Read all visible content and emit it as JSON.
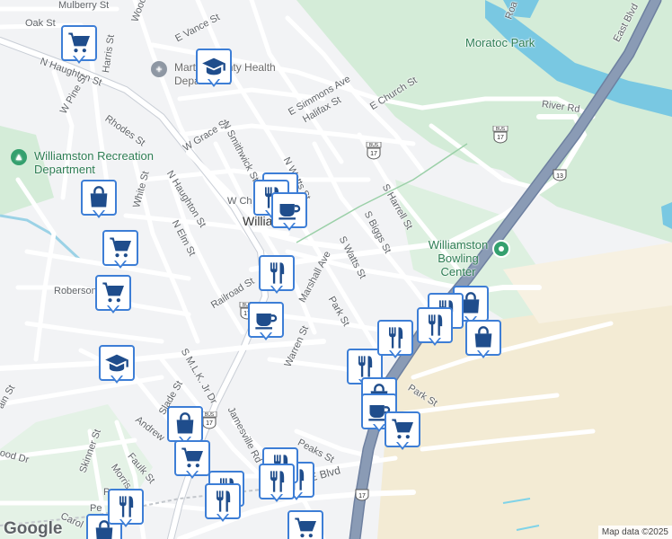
{
  "map": {
    "attribution": "Map data ©2025",
    "logo": "Google",
    "colors": {
      "park": "#d4ecd8",
      "water": "#79c8e2",
      "highway": "#8a9bb5",
      "pin_border": "#3d7ed6",
      "poi_text": "#2e7d54",
      "commercial": "#f3ebd4"
    }
  },
  "streets": [
    {
      "id": "s1",
      "text": "Mulberry St"
    },
    {
      "id": "s2",
      "text": "Oak St"
    },
    {
      "id": "s3",
      "text": "Woodlawn"
    },
    {
      "id": "s4",
      "text": "E Vance St"
    },
    {
      "id": "s5",
      "text": "Harris St"
    },
    {
      "id": "s6",
      "text": "N Haughton St"
    },
    {
      "id": "s7",
      "text": "W Pine St"
    },
    {
      "id": "s8",
      "text": "Rhodes St"
    },
    {
      "id": "s9",
      "text": "W Grace St"
    },
    {
      "id": "s10",
      "text": "N Smithwick St"
    },
    {
      "id": "s11",
      "text": "E Simmons Ave"
    },
    {
      "id": "s12",
      "text": "Halifax St"
    },
    {
      "id": "s13",
      "text": "E Church St"
    },
    {
      "id": "s14",
      "text": "River Rd"
    },
    {
      "id": "s15",
      "text": "N Watts St"
    },
    {
      "id": "s16",
      "text": "S Harrell St"
    },
    {
      "id": "s17",
      "text": "White St"
    },
    {
      "id": "s18",
      "text": "N Haughton St"
    },
    {
      "id": "s19",
      "text": "N Elm St"
    },
    {
      "id": "s20",
      "text": "S Biggs St"
    },
    {
      "id": "s21",
      "text": "S Watts St"
    },
    {
      "id": "s22",
      "text": "Marshall Ave"
    },
    {
      "id": "s23",
      "text": "Railroad St"
    },
    {
      "id": "s24",
      "text": "Park St"
    },
    {
      "id": "s25",
      "text": "Roberson"
    },
    {
      "id": "s26",
      "text": "Warren St"
    },
    {
      "id": "s27",
      "text": "S M.L.K. Jr Dr"
    },
    {
      "id": "s28",
      "text": "Slade St"
    },
    {
      "id": "s29",
      "text": "Andrew"
    },
    {
      "id": "s30",
      "text": "Jamesville Rd"
    },
    {
      "id": "s31",
      "text": "Park St"
    },
    {
      "id": "s32",
      "text": "Faulk St"
    },
    {
      "id": "s33",
      "text": "Skinner St"
    },
    {
      "id": "s34",
      "text": "Morris St"
    },
    {
      "id": "s35",
      "text": "Peaks St"
    },
    {
      "id": "s36",
      "text": "E Blvd"
    },
    {
      "id": "s37",
      "text": "East Blvd"
    },
    {
      "id": "s38",
      "text": "ain St"
    },
    {
      "id": "s39",
      "text": "ood Dr"
    },
    {
      "id": "s40",
      "text": "Carol"
    },
    {
      "id": "s41",
      "text": "W Ch"
    },
    {
      "id": "s42",
      "text": "Roa"
    },
    {
      "id": "s43",
      "text": "Pe"
    },
    {
      "id": "s44",
      "text": "Pe"
    }
  ],
  "places": {
    "town": "Williamston",
    "park": "Moratoc Park",
    "rec": "Williamston Recreation Department",
    "health": "Martin County Health Department",
    "bowling": "Williamston Bowling Center"
  },
  "shields": [
    {
      "id": "h1",
      "bus": "BUS",
      "num": "17"
    },
    {
      "id": "h2",
      "bus": "BUS",
      "num": "17"
    },
    {
      "id": "h3",
      "bus": "",
      "num": "13"
    },
    {
      "id": "h4",
      "bus": "BUS",
      "num": "17"
    },
    {
      "id": "h5",
      "bus": "BUS",
      "num": "17"
    },
    {
      "id": "h6",
      "bus": "",
      "num": "17"
    }
  ],
  "pins": [
    {
      "id": "p1",
      "icon": "shopping-cart-icon"
    },
    {
      "id": "p2",
      "icon": "school-icon"
    },
    {
      "id": "p3",
      "icon": "shopping-bag-icon"
    },
    {
      "id": "p4",
      "icon": "restaurant-icon"
    },
    {
      "id": "p5",
      "icon": "restaurant-icon"
    },
    {
      "id": "p6",
      "icon": "cafe-icon"
    },
    {
      "id": "p7",
      "icon": "shopping-cart-icon"
    },
    {
      "id": "p8",
      "icon": "shopping-cart-icon"
    },
    {
      "id": "p9",
      "icon": "restaurant-icon"
    },
    {
      "id": "p10",
      "icon": "cafe-icon"
    },
    {
      "id": "p11",
      "icon": "school-icon"
    },
    {
      "id": "p12",
      "icon": "restaurant-icon"
    },
    {
      "id": "p13",
      "icon": "shopping-bag-icon"
    },
    {
      "id": "p14",
      "icon": "restaurant-icon"
    },
    {
      "id": "p15",
      "icon": "restaurant-icon"
    },
    {
      "id": "p16",
      "icon": "restaurant-icon"
    },
    {
      "id": "p17",
      "icon": "shopping-bag-icon"
    },
    {
      "id": "p18",
      "icon": "restaurant-icon"
    },
    {
      "id": "p19",
      "icon": "shopping-bag-icon"
    },
    {
      "id": "p20",
      "icon": "cafe-icon"
    },
    {
      "id": "p21",
      "icon": "shopping-cart-icon"
    },
    {
      "id": "p22",
      "icon": "shopping-bag-icon"
    },
    {
      "id": "p23",
      "icon": "shopping-cart-icon"
    },
    {
      "id": "p24",
      "icon": "restaurant-icon"
    },
    {
      "id": "p25",
      "icon": "restaurant-icon"
    },
    {
      "id": "p26",
      "icon": "restaurant-icon"
    },
    {
      "id": "p27",
      "icon": "restaurant-icon"
    },
    {
      "id": "p28",
      "icon": "restaurant-icon"
    },
    {
      "id": "p29",
      "icon": "shopping-cart-icon"
    },
    {
      "id": "p30",
      "icon": "shopping-bag-icon"
    }
  ]
}
